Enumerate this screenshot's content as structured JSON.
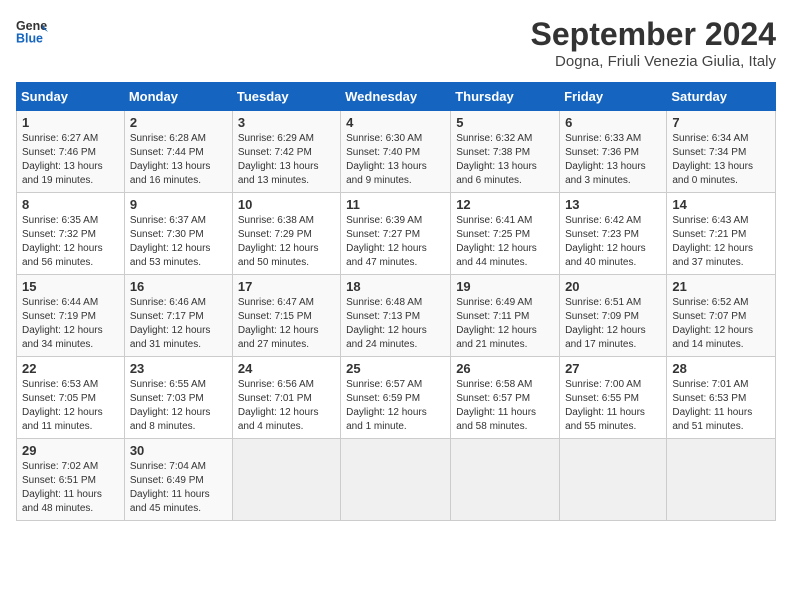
{
  "header": {
    "logo_line1": "General",
    "logo_line2": "Blue",
    "month_year": "September 2024",
    "location": "Dogna, Friuli Venezia Giulia, Italy"
  },
  "days_of_week": [
    "Sunday",
    "Monday",
    "Tuesday",
    "Wednesday",
    "Thursday",
    "Friday",
    "Saturday"
  ],
  "weeks": [
    [
      {
        "day": "1",
        "sunrise": "6:27 AM",
        "sunset": "7:46 PM",
        "daylight": "13 hours and 19 minutes."
      },
      {
        "day": "2",
        "sunrise": "6:28 AM",
        "sunset": "7:44 PM",
        "daylight": "13 hours and 16 minutes."
      },
      {
        "day": "3",
        "sunrise": "6:29 AM",
        "sunset": "7:42 PM",
        "daylight": "13 hours and 13 minutes."
      },
      {
        "day": "4",
        "sunrise": "6:30 AM",
        "sunset": "7:40 PM",
        "daylight": "13 hours and 9 minutes."
      },
      {
        "day": "5",
        "sunrise": "6:32 AM",
        "sunset": "7:38 PM",
        "daylight": "13 hours and 6 minutes."
      },
      {
        "day": "6",
        "sunrise": "6:33 AM",
        "sunset": "7:36 PM",
        "daylight": "13 hours and 3 minutes."
      },
      {
        "day": "7",
        "sunrise": "6:34 AM",
        "sunset": "7:34 PM",
        "daylight": "13 hours and 0 minutes."
      }
    ],
    [
      {
        "day": "8",
        "sunrise": "6:35 AM",
        "sunset": "7:32 PM",
        "daylight": "12 hours and 56 minutes."
      },
      {
        "day": "9",
        "sunrise": "6:37 AM",
        "sunset": "7:30 PM",
        "daylight": "12 hours and 53 minutes."
      },
      {
        "day": "10",
        "sunrise": "6:38 AM",
        "sunset": "7:29 PM",
        "daylight": "12 hours and 50 minutes."
      },
      {
        "day": "11",
        "sunrise": "6:39 AM",
        "sunset": "7:27 PM",
        "daylight": "12 hours and 47 minutes."
      },
      {
        "day": "12",
        "sunrise": "6:41 AM",
        "sunset": "7:25 PM",
        "daylight": "12 hours and 44 minutes."
      },
      {
        "day": "13",
        "sunrise": "6:42 AM",
        "sunset": "7:23 PM",
        "daylight": "12 hours and 40 minutes."
      },
      {
        "day": "14",
        "sunrise": "6:43 AM",
        "sunset": "7:21 PM",
        "daylight": "12 hours and 37 minutes."
      }
    ],
    [
      {
        "day": "15",
        "sunrise": "6:44 AM",
        "sunset": "7:19 PM",
        "daylight": "12 hours and 34 minutes."
      },
      {
        "day": "16",
        "sunrise": "6:46 AM",
        "sunset": "7:17 PM",
        "daylight": "12 hours and 31 minutes."
      },
      {
        "day": "17",
        "sunrise": "6:47 AM",
        "sunset": "7:15 PM",
        "daylight": "12 hours and 27 minutes."
      },
      {
        "day": "18",
        "sunrise": "6:48 AM",
        "sunset": "7:13 PM",
        "daylight": "12 hours and 24 minutes."
      },
      {
        "day": "19",
        "sunrise": "6:49 AM",
        "sunset": "7:11 PM",
        "daylight": "12 hours and 21 minutes."
      },
      {
        "day": "20",
        "sunrise": "6:51 AM",
        "sunset": "7:09 PM",
        "daylight": "12 hours and 17 minutes."
      },
      {
        "day": "21",
        "sunrise": "6:52 AM",
        "sunset": "7:07 PM",
        "daylight": "12 hours and 14 minutes."
      }
    ],
    [
      {
        "day": "22",
        "sunrise": "6:53 AM",
        "sunset": "7:05 PM",
        "daylight": "12 hours and 11 minutes."
      },
      {
        "day": "23",
        "sunrise": "6:55 AM",
        "sunset": "7:03 PM",
        "daylight": "12 hours and 8 minutes."
      },
      {
        "day": "24",
        "sunrise": "6:56 AM",
        "sunset": "7:01 PM",
        "daylight": "12 hours and 4 minutes."
      },
      {
        "day": "25",
        "sunrise": "6:57 AM",
        "sunset": "6:59 PM",
        "daylight": "12 hours and 1 minute."
      },
      {
        "day": "26",
        "sunrise": "6:58 AM",
        "sunset": "6:57 PM",
        "daylight": "11 hours and 58 minutes."
      },
      {
        "day": "27",
        "sunrise": "7:00 AM",
        "sunset": "6:55 PM",
        "daylight": "11 hours and 55 minutes."
      },
      {
        "day": "28",
        "sunrise": "7:01 AM",
        "sunset": "6:53 PM",
        "daylight": "11 hours and 51 minutes."
      }
    ],
    [
      {
        "day": "29",
        "sunrise": "7:02 AM",
        "sunset": "6:51 PM",
        "daylight": "11 hours and 48 minutes."
      },
      {
        "day": "30",
        "sunrise": "7:04 AM",
        "sunset": "6:49 PM",
        "daylight": "11 hours and 45 minutes."
      },
      null,
      null,
      null,
      null,
      null
    ]
  ]
}
